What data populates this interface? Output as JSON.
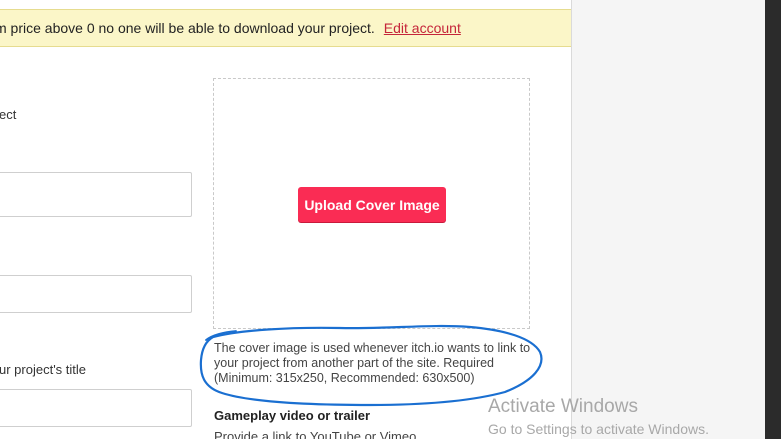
{
  "notice": {
    "text": "m price above 0 no one will be able to download your project.",
    "link_label": "Edit account"
  },
  "form": {
    "label_1": "ect",
    "label_2": "ur project's title"
  },
  "cover": {
    "upload_label": "Upload Cover Image",
    "help": "The cover image is used whenever itch.io wants to link to your project from another part of the site. Required (Minimum: 315x250, Recommended: 630x500)"
  },
  "gameplay": {
    "title": "Gameplay video or trailer",
    "desc": "Provide a link to YouTube or Vimeo."
  },
  "watermark": {
    "title": "Activate Windows",
    "subtitle": "Go to Settings to activate Windows."
  },
  "colors": {
    "accent": "#fa2c54",
    "notice_bg": "#fbf6c8",
    "link": "#c5253a",
    "annotation_ink": "#1a6fd1"
  }
}
